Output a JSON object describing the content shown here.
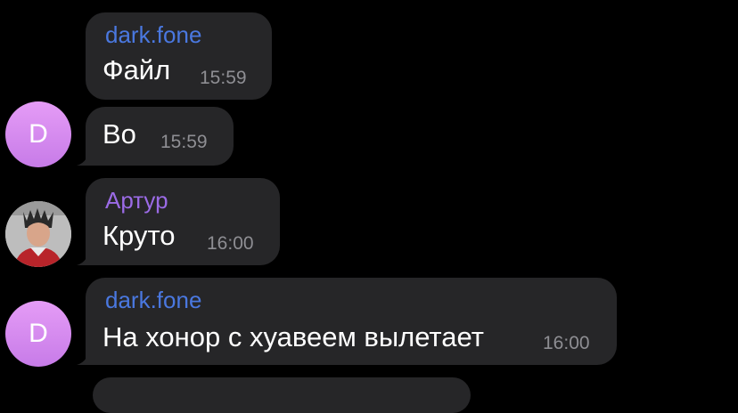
{
  "messages": [
    {
      "sender": "dark.fone",
      "sender_color": "#4a78e0",
      "text": "Файл",
      "time": "15:59"
    },
    {
      "sender": "",
      "text": "Во",
      "time": "15:59",
      "avatar_letter": "D"
    },
    {
      "sender": "Артур",
      "sender_color": "#9b6be6",
      "text": "Круто",
      "time": "16:00",
      "avatar_photo": true
    },
    {
      "sender": "dark.fone",
      "sender_color": "#4a78e0",
      "text": "На хонор с хуавеем вылетает",
      "time": "16:00",
      "avatar_letter": "D"
    }
  ],
  "colors": {
    "background": "#000000",
    "bubble": "#262628",
    "time": "#8e8e93",
    "avatar_gradient_top": "#e59cf6",
    "avatar_gradient_bottom": "#c77be8"
  }
}
